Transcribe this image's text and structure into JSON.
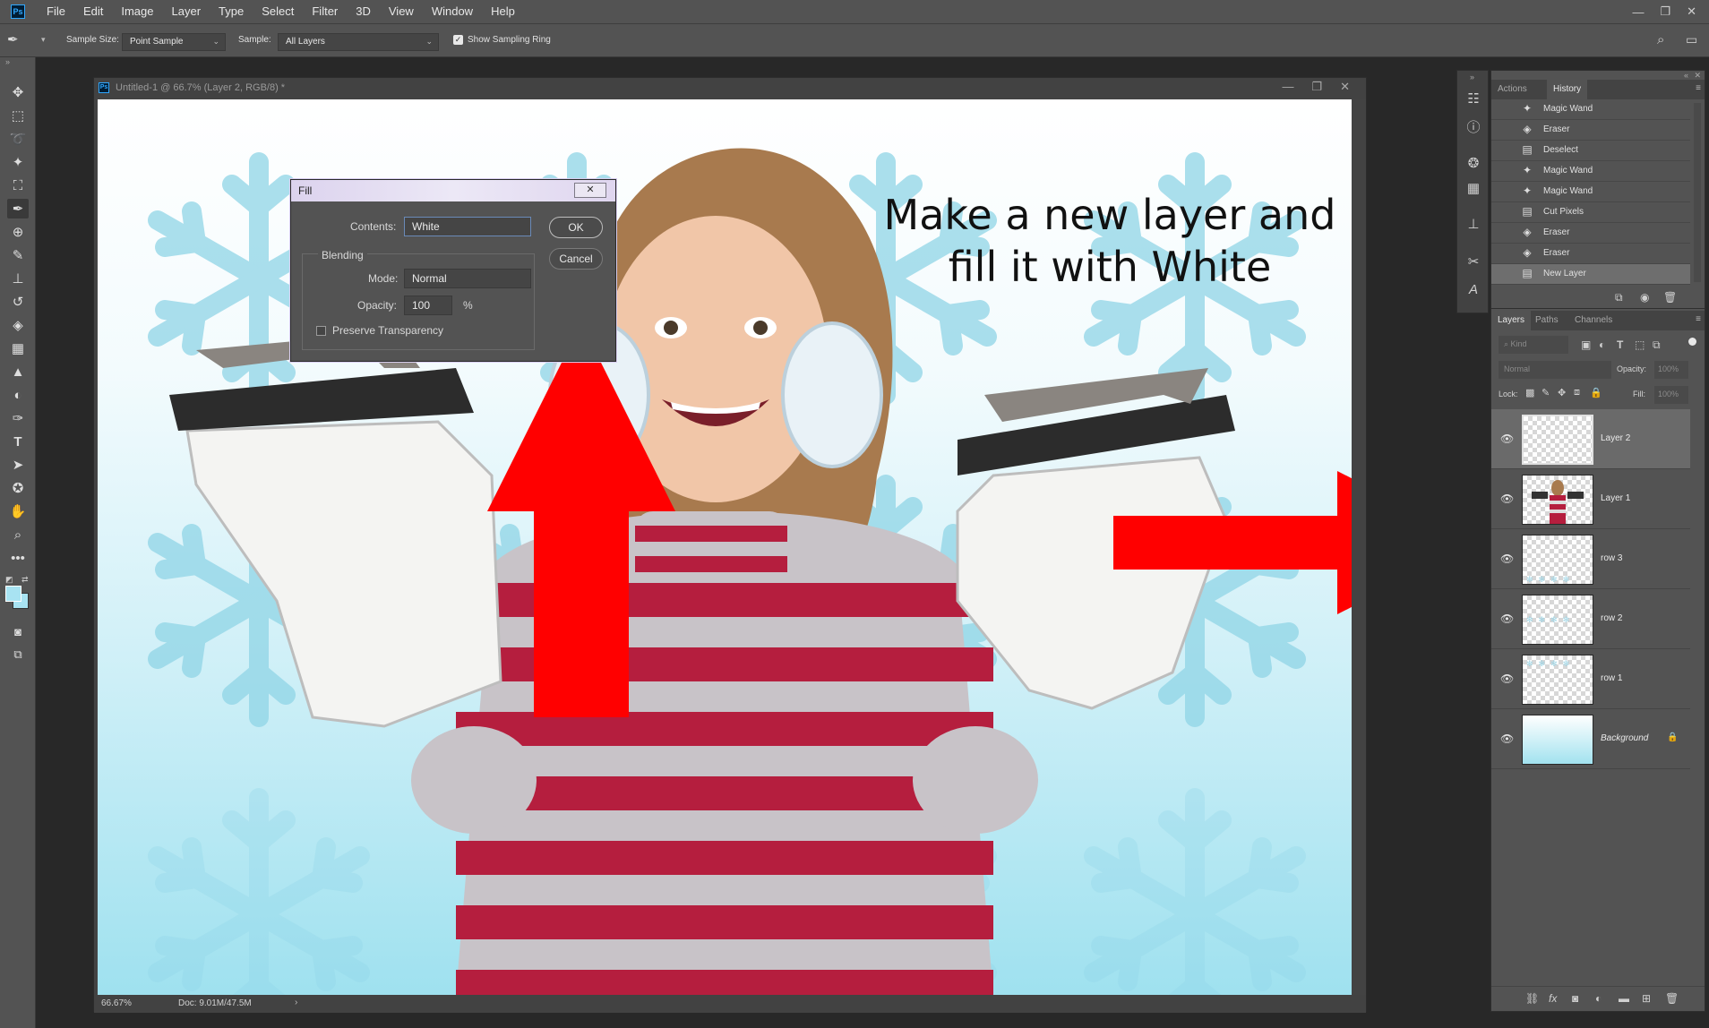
{
  "app": {
    "logo": "Ps"
  },
  "menu": [
    "File",
    "Edit",
    "Image",
    "Layer",
    "Type",
    "Select",
    "Filter",
    "3D",
    "View",
    "Window",
    "Help"
  ],
  "window_controls": [
    "—",
    "❐",
    "✕"
  ],
  "options_bar": {
    "sample_size_label": "Sample Size:",
    "sample_size_value": "Point Sample",
    "sample_label": "Sample:",
    "sample_value": "All Layers",
    "show_sampling_ring": "Show Sampling Ring"
  },
  "document": {
    "title": "Untitled-1 @ 66.7% (Layer 2, RGB/8) *",
    "zoom": "66.67%",
    "doc_size": "Doc: 9.01M/47.5M"
  },
  "annotation": {
    "line1": "Make a new layer and",
    "line2": "fill it with White",
    "color": "#ff0000"
  },
  "fill_dialog": {
    "title": "Fill",
    "close": "✕",
    "contents_label": "Contents:",
    "contents_value": "White",
    "blending_label": "Blending",
    "mode_label": "Mode:",
    "mode_value": "Normal",
    "opacity_label": "Opacity:",
    "opacity_value": "100",
    "opacity_unit": "%",
    "preserve_label": "Preserve Transparency",
    "ok": "OK",
    "cancel": "Cancel"
  },
  "history_panel": {
    "tabs": [
      "Actions",
      "History"
    ],
    "items": [
      {
        "label": "Magic Wand",
        "icon": "magic-wand-icon"
      },
      {
        "label": "Eraser",
        "icon": "eraser-icon"
      },
      {
        "label": "Deselect",
        "icon": "document-icon"
      },
      {
        "label": "Magic Wand",
        "icon": "magic-wand-icon"
      },
      {
        "label": "Magic Wand",
        "icon": "magic-wand-icon"
      },
      {
        "label": "Cut Pixels",
        "icon": "document-icon"
      },
      {
        "label": "Eraser",
        "icon": "eraser-icon"
      },
      {
        "label": "Eraser",
        "icon": "eraser-icon"
      },
      {
        "label": "New Layer",
        "icon": "document-icon"
      }
    ]
  },
  "layers_panel": {
    "tabs": [
      "Layers",
      "Paths",
      "Channels"
    ],
    "kind_label": "Kind",
    "blend_mode": "Normal",
    "opacity_label": "Opacity:",
    "opacity_value": "100%",
    "lock_label": "Lock:",
    "fill_label": "Fill:",
    "fill_value": "100%",
    "layers": [
      {
        "name": "Layer 2"
      },
      {
        "name": "Layer 1"
      },
      {
        "name": "row 3"
      },
      {
        "name": "row 2"
      },
      {
        "name": "row 1"
      },
      {
        "name": "Background"
      }
    ]
  },
  "colors": {
    "accent_red": "#ff0000",
    "foreground_swatch": "#a8e3f2",
    "background_swatch": "#a8e3f2"
  }
}
